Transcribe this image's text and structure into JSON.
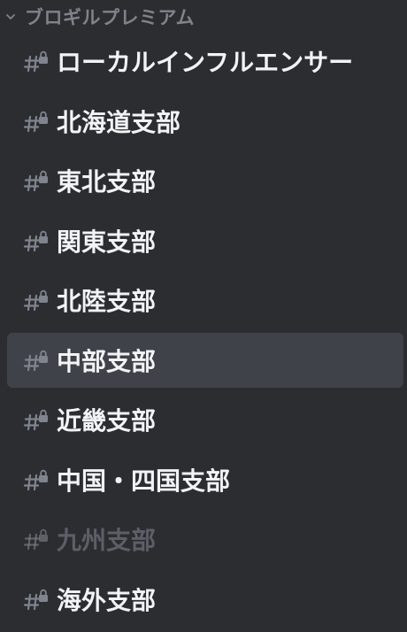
{
  "category": {
    "label": "ブロギルプレミアム",
    "expanded": true,
    "chevron_icon": "chevron-down-icon"
  },
  "colors": {
    "background": "#2b2d31",
    "selected_background": "#404249",
    "channel_text": "#f2f3f5",
    "muted_text": "#5c5f66",
    "category_text": "#7f838a",
    "icon_color": "#80848e"
  },
  "channels": [
    {
      "name": "ローカルインフルエンサー",
      "icon": "locked-text-channel-icon",
      "selected": false,
      "muted": false
    },
    {
      "name": "北海道支部",
      "icon": "locked-text-channel-icon",
      "selected": false,
      "muted": false
    },
    {
      "name": "東北支部",
      "icon": "locked-text-channel-icon",
      "selected": false,
      "muted": false
    },
    {
      "name": "関東支部",
      "icon": "locked-text-channel-icon",
      "selected": false,
      "muted": false
    },
    {
      "name": "北陸支部",
      "icon": "locked-text-channel-icon",
      "selected": false,
      "muted": false
    },
    {
      "name": "中部支部",
      "icon": "locked-text-channel-icon",
      "selected": true,
      "muted": false
    },
    {
      "name": "近畿支部",
      "icon": "locked-text-channel-icon",
      "selected": false,
      "muted": false
    },
    {
      "name": "中国・四国支部",
      "icon": "locked-text-channel-icon",
      "selected": false,
      "muted": false
    },
    {
      "name": "九州支部",
      "icon": "locked-text-channel-icon",
      "selected": false,
      "muted": true
    },
    {
      "name": "海外支部",
      "icon": "locked-text-channel-icon",
      "selected": false,
      "muted": false
    }
  ]
}
